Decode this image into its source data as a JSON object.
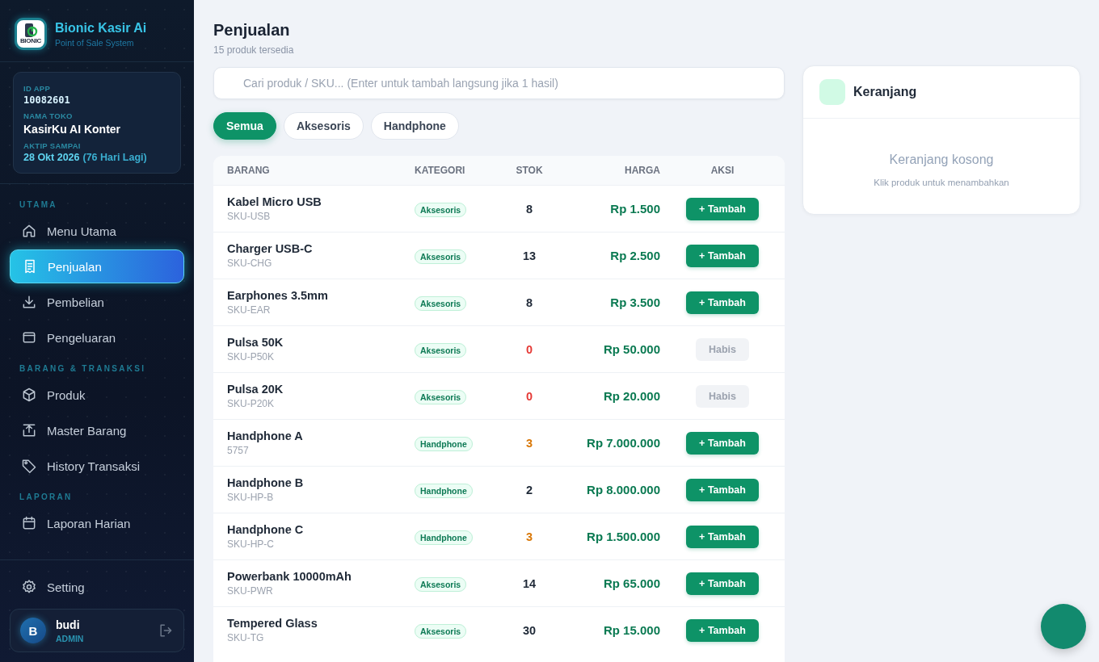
{
  "brand": {
    "logo_text": "BIONIC",
    "name": "Bionic Kasir Ai",
    "tagline": "Point of Sale System"
  },
  "app_info": [
    {
      "label": "ID APP",
      "value": "10082601",
      "kind": "mono"
    },
    {
      "label": "NAMA TOKO",
      "value": "KasirKu AI Konter",
      "kind": "name"
    },
    {
      "label": "AKTIP SAMPAI",
      "value": "28 Okt 2026",
      "note": "(76 Hari Lagi)",
      "kind": "date"
    }
  ],
  "sidebar": {
    "sections": [
      {
        "title": "UTAMA",
        "items": [
          {
            "label": "Menu Utama",
            "kind": "home",
            "selected": false
          },
          {
            "label": "Penjualan",
            "kind": "receipt",
            "selected": true
          },
          {
            "label": "Pembelian",
            "kind": "download",
            "selected": false
          },
          {
            "label": "Pengeluaran",
            "kind": "wallet",
            "selected": false
          }
        ]
      },
      {
        "title": "BARANG & TRANSAKSI",
        "items": [
          {
            "label": "Produk",
            "kind": "box",
            "selected": false
          },
          {
            "label": "Master Barang",
            "kind": "upload",
            "selected": false
          },
          {
            "label": "History Transaksi",
            "kind": "tag",
            "selected": false
          }
        ]
      },
      {
        "title": "LAPORAN",
        "items": [
          {
            "label": "Laporan Harian",
            "kind": "calendar",
            "selected": false
          }
        ]
      }
    ],
    "footer_item": {
      "label": "Setting",
      "kind": "gear",
      "selected": false
    },
    "user": {
      "initial": "B",
      "name": "budi",
      "role": "ADMIN"
    }
  },
  "page": {
    "title": "Penjualan",
    "subtitle": "15 produk tersedia"
  },
  "search": {
    "placeholder": "Cari produk / SKU... (Enter untuk tambah langsung jika 1 hasil)"
  },
  "filters": [
    {
      "label": "Semua",
      "selected": true
    },
    {
      "label": "Aksesoris",
      "selected": false
    },
    {
      "label": "Handphone",
      "selected": false
    }
  ],
  "table": {
    "columns": [
      "BARANG",
      "KATEGORI",
      "STOK",
      "HARGA",
      "AKSI"
    ],
    "rows": [
      {
        "name": "Kabel Micro USB",
        "sku": "SKU-USB",
        "category": "Aksesoris",
        "stock": "8",
        "kind": "normal",
        "price": "Rp 1.500",
        "action": "+ Tambah",
        "disabled": false
      },
      {
        "name": "Charger USB-C",
        "sku": "SKU-CHG",
        "category": "Aksesoris",
        "stock": "13",
        "kind": "normal",
        "price": "Rp 2.500",
        "action": "+ Tambah",
        "disabled": false
      },
      {
        "name": "Earphones 3.5mm",
        "sku": "SKU-EAR",
        "category": "Aksesoris",
        "stock": "8",
        "kind": "normal",
        "price": "Rp 3.500",
        "action": "+ Tambah",
        "disabled": false
      },
      {
        "name": "Pulsa 50K",
        "sku": "SKU-P50K",
        "category": "Aksesoris",
        "stock": "0",
        "kind": "out",
        "price": "Rp 50.000",
        "action": "Habis",
        "disabled": true
      },
      {
        "name": "Pulsa 20K",
        "sku": "SKU-P20K",
        "category": "Aksesoris",
        "stock": "0",
        "kind": "out",
        "price": "Rp 20.000",
        "action": "Habis",
        "disabled": true
      },
      {
        "name": "Handphone A",
        "sku": "5757",
        "category": "Handphone",
        "stock": "3",
        "kind": "low",
        "price": "Rp 7.000.000",
        "action": "+ Tambah",
        "disabled": false
      },
      {
        "name": "Handphone B",
        "sku": "SKU-HP-B",
        "category": "Handphone",
        "stock": "2",
        "kind": "normal",
        "price": "Rp 8.000.000",
        "action": "+ Tambah",
        "disabled": false
      },
      {
        "name": "Handphone C",
        "sku": "SKU-HP-C",
        "category": "Handphone",
        "stock": "3",
        "kind": "low",
        "price": "Rp 1.500.000",
        "action": "+ Tambah",
        "disabled": false
      },
      {
        "name": "Powerbank 10000mAh",
        "sku": "SKU-PWR",
        "category": "Aksesoris",
        "stock": "14",
        "kind": "normal",
        "price": "Rp 65.000",
        "action": "+ Tambah",
        "disabled": false
      },
      {
        "name": "Tempered Glass",
        "sku": "SKU-TG",
        "category": "Aksesoris",
        "stock": "30",
        "kind": "normal",
        "price": "Rp 15.000",
        "action": "+ Tambah",
        "disabled": false
      }
    ]
  },
  "cart": {
    "title": "Keranjang",
    "empty_title": "Keranjang kosong",
    "empty_hint": "Klik produk untuk menambahkan"
  }
}
